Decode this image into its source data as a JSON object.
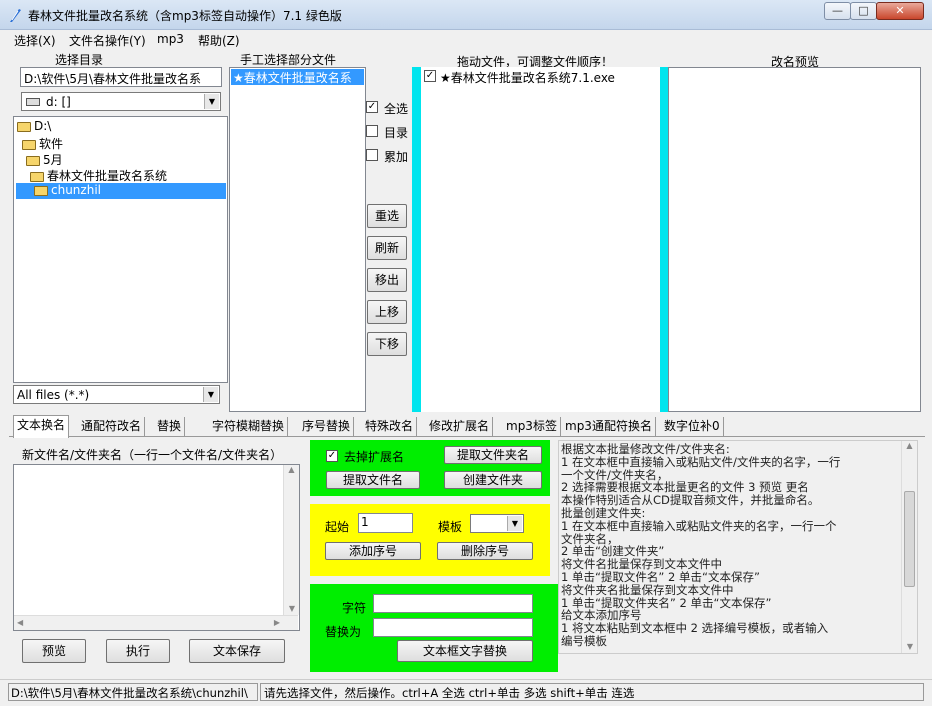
{
  "window": {
    "title": "春林文件批量改名系统（含mp3标签自动操作）7.1  绿色版",
    "min_glyph": "—",
    "max_glyph": "□",
    "close_glyph": "✕"
  },
  "menu": [
    "选择(X)",
    "文件名操作(Y)",
    "mp3",
    "帮助(Z)"
  ],
  "left_panel": {
    "header": "选择目录",
    "path_value": "D:\\软件\\5月\\春林文件批量改名系",
    "drive_value": "d: []",
    "tree": [
      "D:\\",
      "软件",
      "5月",
      "春林文件批量改名系统",
      "chunzhil"
    ],
    "filter_value": "All files (*.*)"
  },
  "manual_panel": {
    "header": "手工选择部分文件",
    "items": [
      "★春林文件批量改名系"
    ]
  },
  "side_controls": {
    "select_all": "全选",
    "directory": "目录",
    "accumulate": "累加",
    "reselect": "重选",
    "refresh": "刷新",
    "remove": "移出",
    "move_up": "上移",
    "move_down": "下移"
  },
  "drag_panel": {
    "header": "拖动文件，可调整文件顺序！",
    "items": [
      "★春林文件批量改名系统7.1.exe"
    ]
  },
  "preview_panel": {
    "header": "改名预览"
  },
  "tabs": [
    "文本换名",
    "通配符改名",
    "替换",
    "字符模糊替换",
    "序号替换",
    "特殊改名",
    "修改扩展名",
    "mp3标签",
    "mp3通配符换名",
    "数字位补0"
  ],
  "text_rename": {
    "label": "新文件名/文件夹名（一行一个文件名/文件夹名）",
    "preview_btn": "预览",
    "execute_btn": "执行",
    "save_btn": "文本保存"
  },
  "green_box": {
    "remove_ext": "去掉扩展名",
    "extract_folder": "提取文件夹名",
    "extract_file": "提取文件名",
    "create_folder": "创建文件夹"
  },
  "yellow_box": {
    "start_label": "起始",
    "start_value": "1",
    "template_label": "模板",
    "add_seq": "添加序号",
    "del_seq": "删除序号"
  },
  "green_box2": {
    "char_label": "字符",
    "replace_label": "替换为",
    "replace_btn": "文本框文字替换"
  },
  "help_text": [
    "根据文本批量修改文件/文件夹名:",
    "  1 在文本框中直接输入或粘贴文件/文件夹的名字，一行",
    "一个文件/文件夹名，",
    "  2 选择需要根据文本批量更名的文件    3 预览 更名",
    "  本操作特别适合从CD提取音频文件，并批量命名。",
    "批量创建文件夹:",
    "  1 在文本框中直接输入或粘贴文件夹的名字，一行一个",
    "文件夹名，",
    "  2 单击“创建文件夹”",
    "将文件名批量保存到文本文件中",
    "  1 单击“提取文件名”    2 单击“文本保存”",
    "将文件夹名批量保存到文本文件中",
    "  1 单击“提取文件夹名”    2 单击“文本保存”",
    "给文本添加序号",
    "  1 将文本粘贴到文本框中    2 选择编号模板，或者输入",
    "编号模板"
  ],
  "status": {
    "path": "D:\\软件\\5月\\春林文件批量改名系统\\chunzhil\\",
    "hint": "请先选择文件，然后操作。ctrl+A 全选 ctrl+单击 多选 shift+单击 连选"
  },
  "colors": {
    "cyan": "#00e5ee",
    "green": "#00ee00",
    "yellow": "#ffff00",
    "selection": "#3399ff"
  }
}
